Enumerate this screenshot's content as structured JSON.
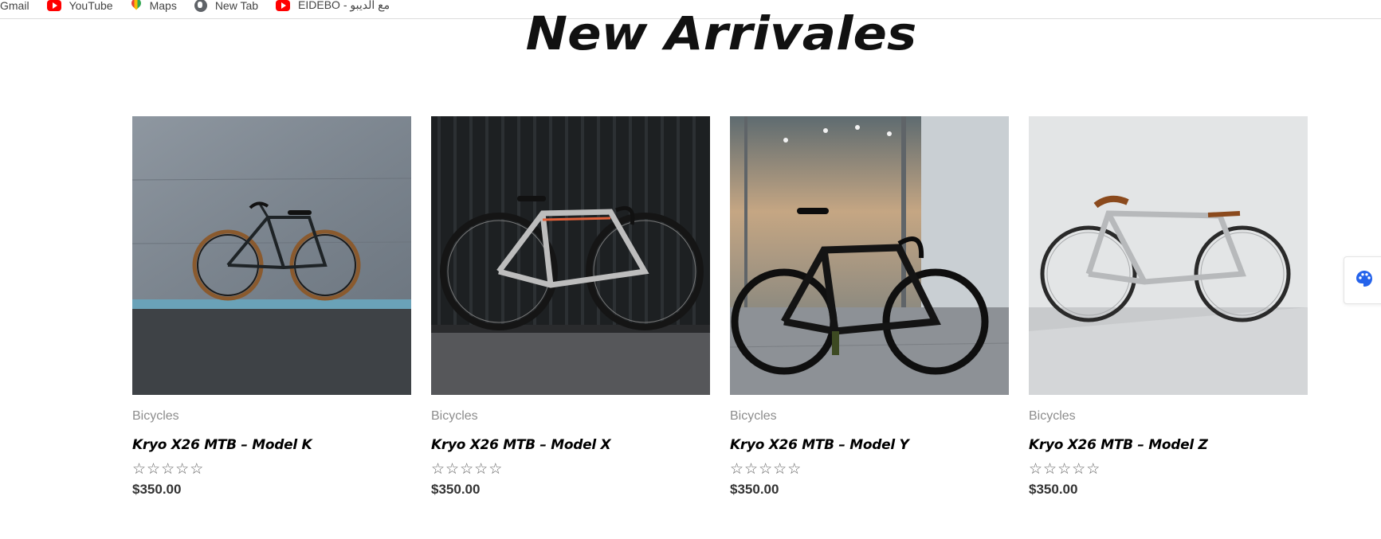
{
  "bookmarks": [
    {
      "label": "Gmail",
      "icon": "gmail-icon"
    },
    {
      "label": "YouTube",
      "icon": "youtube-icon"
    },
    {
      "label": "Maps",
      "icon": "maps-icon"
    },
    {
      "label": "New Tab",
      "icon": "globe-icon"
    },
    {
      "label": "EIDEBO - مع الديبو",
      "icon": "youtube-icon"
    }
  ],
  "section": {
    "heading": "New Arrivales"
  },
  "products": [
    {
      "category": "Bicycles",
      "title": "Kryo X26 MTB – Model K",
      "price": "$350.00",
      "rating": 0,
      "image": "black-fixie-on-gray-wall"
    },
    {
      "category": "Bicycles",
      "title": "Kryo X26 MTB – Model X",
      "price": "$350.00",
      "rating": 0,
      "image": "silver-road-bike-dark-background"
    },
    {
      "category": "Bicycles",
      "title": "Kryo X26 MTB – Model Y",
      "price": "$350.00",
      "rating": 0,
      "image": "black-track-bike-glass-storefront"
    },
    {
      "category": "Bicycles",
      "title": "Kryo X26 MTB – Model Z",
      "price": "$350.00",
      "rating": 0,
      "image": "white-fixie-brown-saddle"
    }
  ],
  "side_tab": {
    "icon": "palette-icon",
    "color": "#2563eb"
  }
}
